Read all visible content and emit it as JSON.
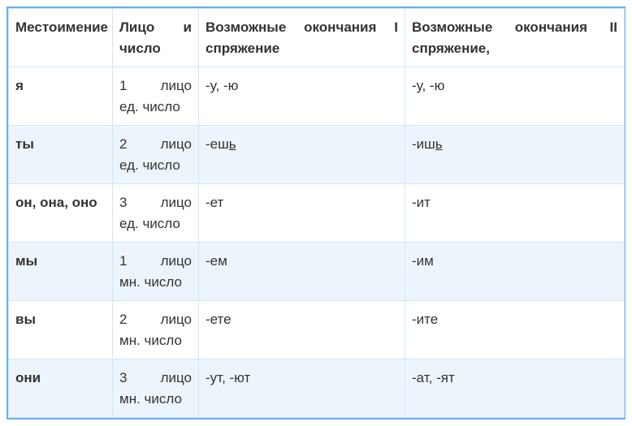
{
  "headers": {
    "pronoun": "Местоимение",
    "person_number": "Лицо и число",
    "endings_i": "Возможные окончания I спряжение",
    "endings_ii": "Возможные окончания II спряжение,"
  },
  "rows": [
    {
      "pronoun": "я",
      "person_l1": "1 лицо",
      "person_l2": "ед. число",
      "conj1_pre": "-у, -ю",
      "conj1_ul": "",
      "conj2_pre": "-у, -ю",
      "conj2_ul": ""
    },
    {
      "pronoun": "ты",
      "person_l1": "2 лицо",
      "person_l2": "ед. число",
      "conj1_pre": "-еш",
      "conj1_ul": "ь",
      "conj2_pre": "-иш",
      "conj2_ul": "ь"
    },
    {
      "pronoun": "он, она, оно",
      "person_l1": "3 лицо",
      "person_l2": "ед. число",
      "conj1_pre": "-ет",
      "conj1_ul": "",
      "conj2_pre": "-ит",
      "conj2_ul": ""
    },
    {
      "pronoun": "мы",
      "person_l1": "1 лицо",
      "person_l2": "мн. число",
      "conj1_pre": "-ем",
      "conj1_ul": "",
      "conj2_pre": "-им",
      "conj2_ul": ""
    },
    {
      "pronoun": "вы",
      "person_l1": "2 лицо",
      "person_l2": "мн. число",
      "conj1_pre": "-ете",
      "conj1_ul": "",
      "conj2_pre": "-ите",
      "conj2_ul": ""
    },
    {
      "pronoun": "они",
      "person_l1": "3 лицо",
      "person_l2": "мн. число",
      "conj1_pre": "-ут, -ют",
      "conj1_ul": "",
      "conj2_pre": "-ат, -ят",
      "conj2_ul": ""
    }
  ]
}
